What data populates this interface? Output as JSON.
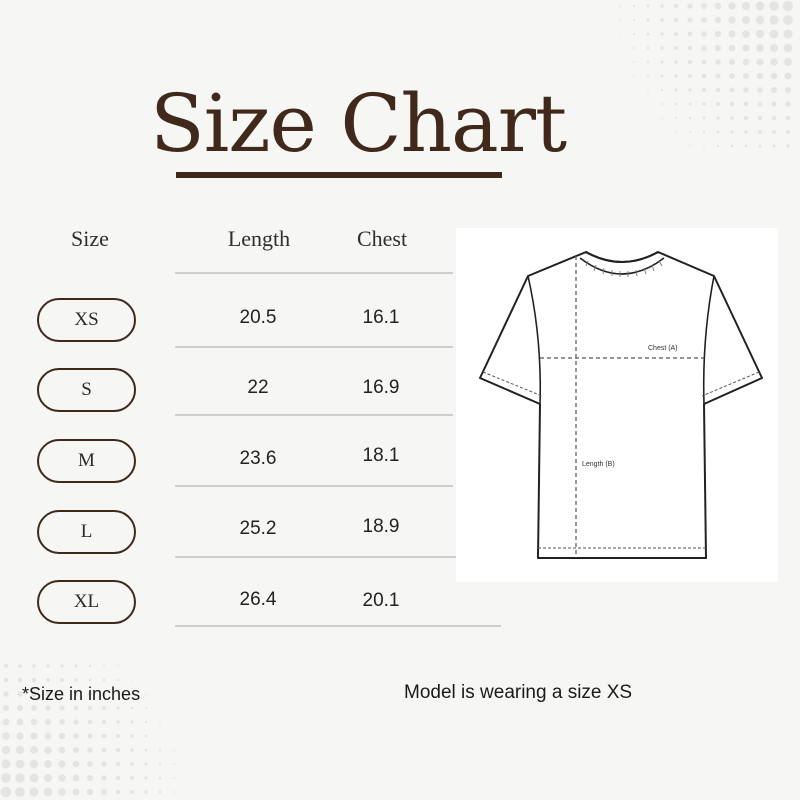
{
  "title": "Size Chart",
  "headers": {
    "size": "Size",
    "length": "Length",
    "chest": "Chest"
  },
  "rows": [
    {
      "size": "XS",
      "length": "20.5",
      "chest": "16.1"
    },
    {
      "size": "S",
      "length": "22",
      "chest": "16.9"
    },
    {
      "size": "M",
      "length": "23.6",
      "chest": "18.1"
    },
    {
      "size": "L",
      "length": "25.2",
      "chest": "18.9"
    },
    {
      "size": "XL",
      "length": "26.4",
      "chest": "20.1"
    }
  ],
  "diagram": {
    "chest_label": "Chest (A)",
    "length_label": "Length (B)"
  },
  "footnote": "*Size in inches",
  "model_note": "Model is wearing a size XS",
  "colors": {
    "accent": "#40291b",
    "background": "#f6f6f5"
  },
  "icons": {
    "garment": "tshirt-icon"
  }
}
